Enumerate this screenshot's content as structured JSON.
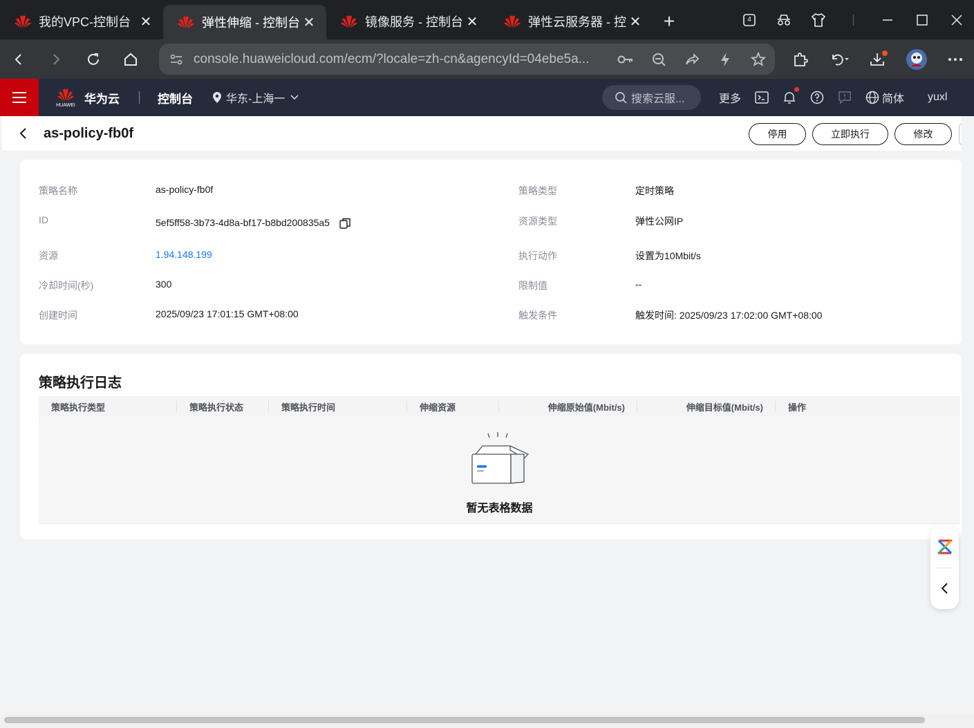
{
  "browser": {
    "tabs": [
      {
        "title": "我的VPC-控制台",
        "close": "✕",
        "active": false
      },
      {
        "title": "弹性伸缩 - 控制台",
        "close": "✕",
        "active": true
      },
      {
        "title": "镜像服务 - 控制台",
        "close": "✕",
        "active": false
      },
      {
        "title": "弹性云服务器 - 控",
        "close": "✕",
        "active": false
      }
    ],
    "new_tab": "+",
    "tab_count_badge": "4",
    "url": "console.huaweicloud.com/ecm/?locale=zh-cn&agencyId=04ebe5a..."
  },
  "header": {
    "brand_name": "华为云",
    "logo_caption": "HUAWEI",
    "console_title": "控制台",
    "region": "华东-上海一",
    "search_placeholder": "搜索云服...",
    "more": "更多",
    "language": "简体",
    "user": "yuxl"
  },
  "page": {
    "title": "as-policy-fb0f",
    "actions": {
      "disable": "停用",
      "execute_now": "立即执行",
      "modify": "修改"
    }
  },
  "details": {
    "left": [
      {
        "label": "策略名称",
        "value": "as-policy-fb0f"
      },
      {
        "label": "ID",
        "value": "5ef5ff58-3b73-4d8a-bf17-b8bd200835a5"
      },
      {
        "label": "资源",
        "value": "1.94.148.199"
      },
      {
        "label": "冷却时间(秒)",
        "value": "300"
      },
      {
        "label": "创建时间",
        "value": "2025/09/23 17:01:15 GMT+08:00"
      }
    ],
    "right": [
      {
        "label": "策略类型",
        "value": "定时策略"
      },
      {
        "label": "资源类型",
        "value": "弹性公网IP"
      },
      {
        "label": "执行动作",
        "value": "设置为10Mbit/s"
      },
      {
        "label": "限制值",
        "value": "--"
      },
      {
        "label": "触发条件",
        "value": "触发时间: 2025/09/23 17:02:00 GMT+08:00"
      }
    ]
  },
  "log": {
    "title": "策略执行日志",
    "columns": [
      "策略执行类型",
      "策略执行状态",
      "策略执行时间",
      "伸缩资源",
      "伸缩原始值(Mbit/s)",
      "伸缩目标值(Mbit/s)",
      "操作"
    ],
    "empty_text": "暂无表格数据"
  },
  "colors": {
    "brand_red": "#c7000b",
    "header_bg": "#252b3a",
    "link": "#1476ff"
  }
}
